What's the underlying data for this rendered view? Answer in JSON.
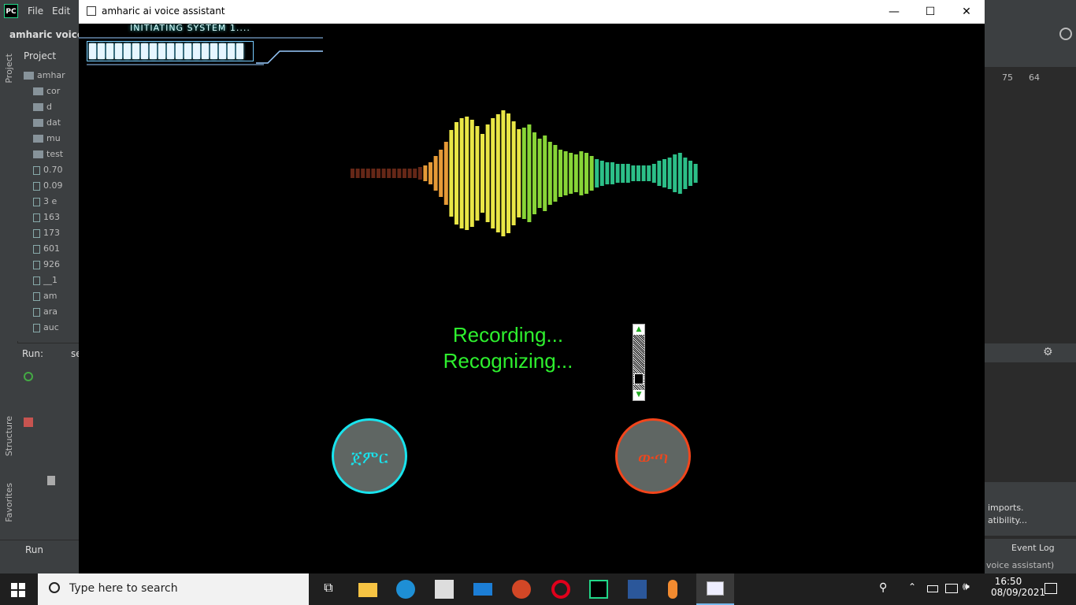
{
  "ide": {
    "logo": "PC",
    "menu": [
      "File",
      "Edit"
    ],
    "project_name": "amharic voice",
    "project_tab": "Project",
    "left_tabs": [
      "Project",
      "Structure",
      "Favorites"
    ],
    "tree": [
      {
        "type": "folder",
        "label": "amhar",
        "root": true
      },
      {
        "type": "folder",
        "label": "cor"
      },
      {
        "type": "folder",
        "label": "d"
      },
      {
        "type": "folder",
        "label": "dat"
      },
      {
        "type": "folder",
        "label": "mu"
      },
      {
        "type": "folder",
        "label": "test"
      },
      {
        "type": "file",
        "label": "0.70"
      },
      {
        "type": "file",
        "label": "0.09"
      },
      {
        "type": "file",
        "label": "3 e"
      },
      {
        "type": "file",
        "label": "163"
      },
      {
        "type": "file",
        "label": "173"
      },
      {
        "type": "file",
        "label": "601"
      },
      {
        "type": "file",
        "label": "926"
      },
      {
        "type": "file",
        "label": "__1"
      },
      {
        "type": "file",
        "label": "am"
      },
      {
        "type": "file",
        "label": "ara"
      },
      {
        "type": "file",
        "label": "auc"
      }
    ],
    "run_label": "Run:",
    "run_tab": "se",
    "run_button": "Run",
    "warnings": "75",
    "checks": "64",
    "notice_line1": "imports.",
    "notice_line2": "atibility...",
    "event_log": "Event Log",
    "status_right": "voice assistant)"
  },
  "app": {
    "title": "amharic ai voice assistant",
    "hud_text": "INITIATING SYSTEM 1....",
    "progress_segments": 18,
    "status_recording": "Recording...",
    "status_recognizing": "Recognizing...",
    "start_button": "ጀምር",
    "stop_button": "ውጣ",
    "colors": {
      "start": "#18e4ee",
      "stop": "#f3451b",
      "status": "#2ef02e"
    }
  },
  "taskbar": {
    "search_placeholder": "Type here to search",
    "time": "16:50",
    "date": "08/09/2021",
    "icons": [
      "task-view-icon",
      "file-explorer-icon",
      "edge-icon",
      "store-icon",
      "mail-icon",
      "powerpoint-icon",
      "opera-icon",
      "pycharm-icon",
      "word-icon",
      "microphone-icon",
      "app-window-icon"
    ]
  }
}
